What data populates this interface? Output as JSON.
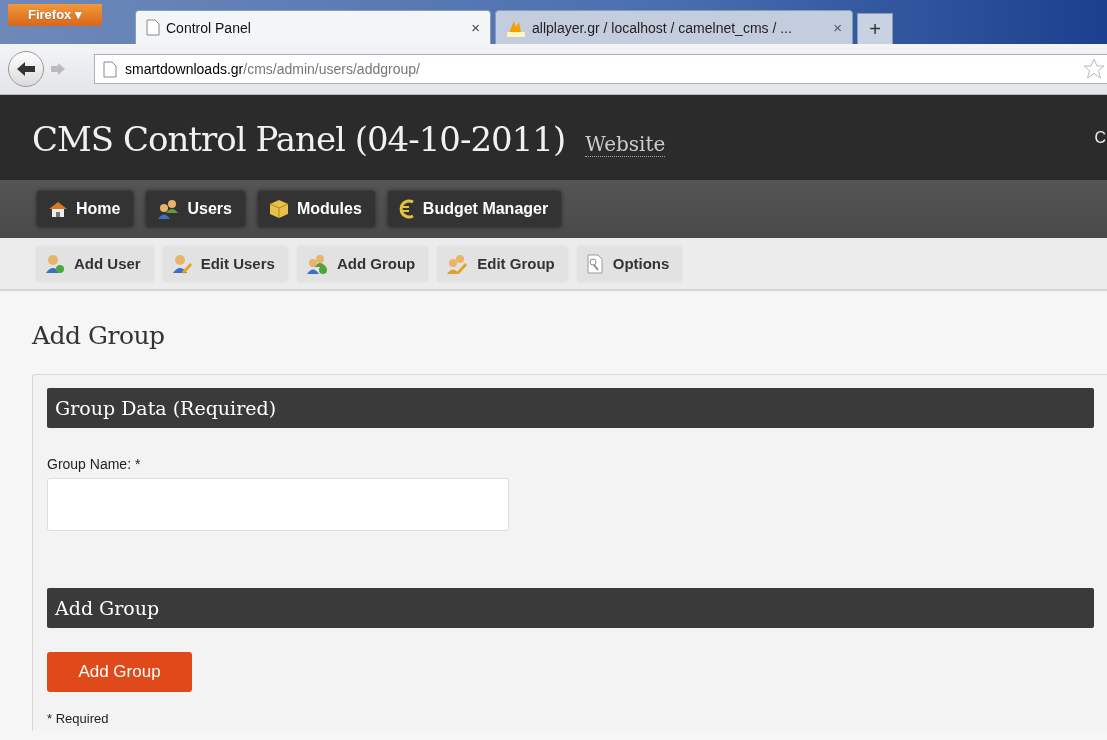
{
  "browser": {
    "menu_button": "Firefox ▾",
    "tabs": [
      {
        "label": "Control Panel",
        "close": "×",
        "selected": true
      },
      {
        "label": "allplayer.gr / localhost / camelnet_cms / ...",
        "close": "×",
        "selected": false
      }
    ],
    "new_tab": "+",
    "address": {
      "domain": "smartdownloads.gr",
      "path": "/cms/admin/users/addgroup/"
    }
  },
  "header": {
    "title": "CMS Control Panel (04-10-2011)",
    "link": "Website",
    "edge_text": "C"
  },
  "main_nav": [
    "Home",
    "Users",
    "Modules",
    "Budget Manager"
  ],
  "sub_nav": [
    "Add User",
    "Edit Users",
    "Add Group",
    "Edit Group",
    "Options"
  ],
  "page_title": "Add Group",
  "sections": [
    {
      "heading": "Group Data (Required)",
      "field_label": "Group Name: *"
    },
    {
      "heading": "Add Group",
      "button": "Add Group",
      "note": "* Required"
    }
  ]
}
